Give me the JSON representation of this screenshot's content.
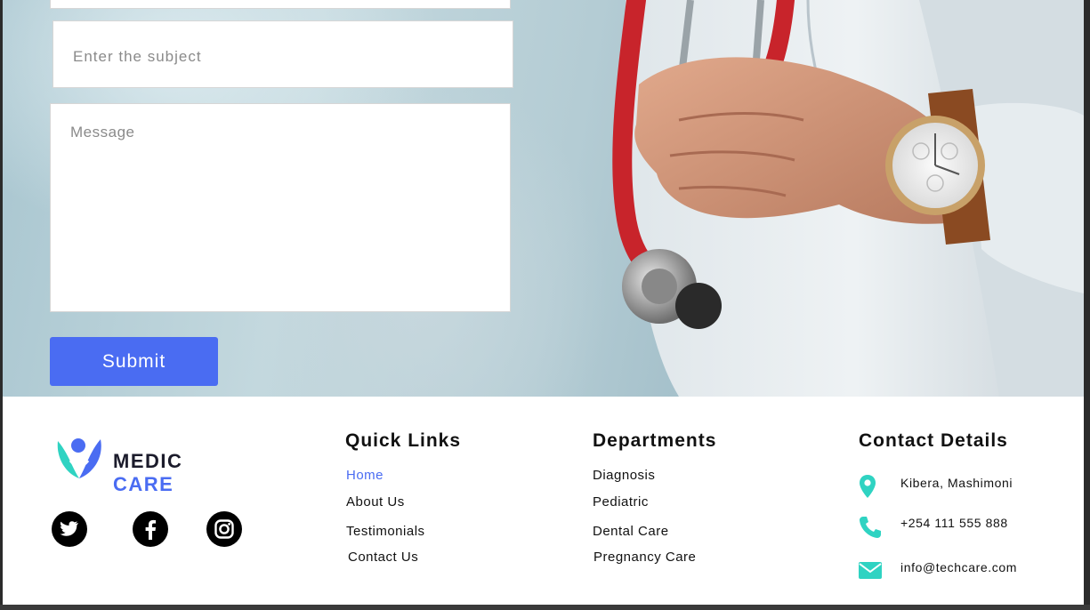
{
  "form": {
    "subject_placeholder": "Enter the subject",
    "message_placeholder": "Message",
    "submit_label": "Submit"
  },
  "logo": {
    "word1": "MEDIC",
    "word2": "CARE"
  },
  "social": [
    {
      "icon": "twitter-icon"
    },
    {
      "icon": "facebook-icon"
    },
    {
      "icon": "instagram-icon"
    }
  ],
  "quick_links": {
    "title": "Quick Links",
    "items": [
      "Home",
      "About Us",
      "Testimonials",
      "Contact Us"
    ],
    "active": "Home"
  },
  "departments": {
    "title": "Departments",
    "items": [
      "Diagnosis",
      "Pediatric",
      "Dental Care",
      "Pregnancy Care"
    ]
  },
  "contact": {
    "title": "Contact Details",
    "address": "Kibera, Mashimoni",
    "phone": "+254 111 555 888",
    "email": "info@techcare.com"
  },
  "colors": {
    "accent": "#4a6cf2",
    "icon_teal": "#2fd3c2",
    "text": "#111111"
  }
}
